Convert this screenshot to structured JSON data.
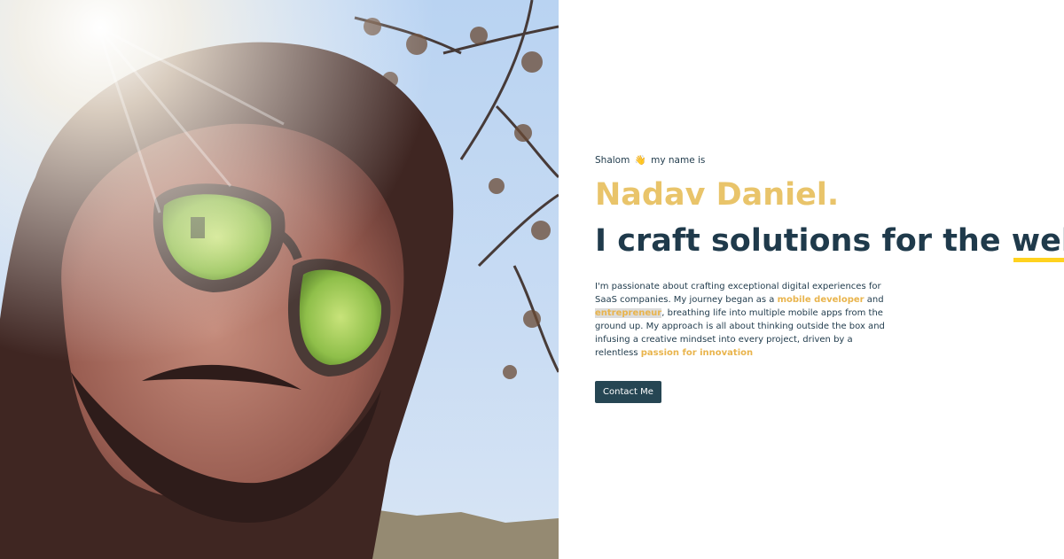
{
  "photo": {
    "alt": "Portrait photo"
  },
  "hero": {
    "greeting_before": "Shalom",
    "wave_icon": "👋",
    "greeting_after": "my name is",
    "name": "Nadav Daniel.",
    "tagline_start": "I craft solutions for the",
    "tagline_highlight": "web",
    "tagline_end": ".",
    "bio": {
      "p1": "I'm passionate about crafting exceptional digital experiences for SaaS companies. My journey began as a ",
      "accent1": "mobile developer",
      "p2": " and ",
      "accent2": "entrepreneur",
      "p3": ", breathing life into multiple mobile apps from the ground up. My approach is all about thinking outside the box and infusing a creative mindset into every project, driven by a relentless ",
      "accent3": "passion for innovation"
    },
    "cta_label": "Contact Me"
  },
  "colors": {
    "accent_gold": "#e9c46a",
    "primary_dark": "#1f3a4b",
    "underline_yellow": "#ffd21f",
    "button_bg": "#264653"
  }
}
